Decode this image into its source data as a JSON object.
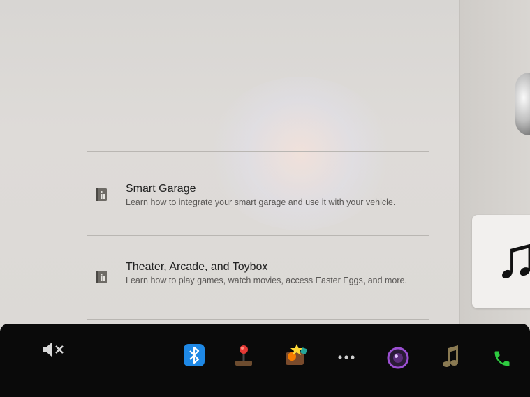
{
  "manual": {
    "entries": [
      {
        "title": "Smart Garage",
        "description": "Learn how to integrate your smart garage and use it with your vehicle.",
        "icon": "manual-book-icon"
      },
      {
        "title": "Theater, Arcade, and Toybox",
        "description": "Learn how to play games, watch movies, access Easter Eggs, and more.",
        "icon": "manual-book-icon"
      }
    ]
  },
  "media_card": {
    "icon": "music-note-icon"
  },
  "taskbar": {
    "icons": [
      "volume-muted-icon",
      "bluetooth-icon",
      "arcade-joystick-icon",
      "toybox-icon",
      "more-apps-icon",
      "camera-icon",
      "music-icon",
      "phone-icon"
    ]
  },
  "colors": {
    "bluetooth": "#1e88e5",
    "joystick": "#e53935",
    "phone": "#2ecc40",
    "camera": "#9b4fd1",
    "music": "#8a7a52"
  }
}
